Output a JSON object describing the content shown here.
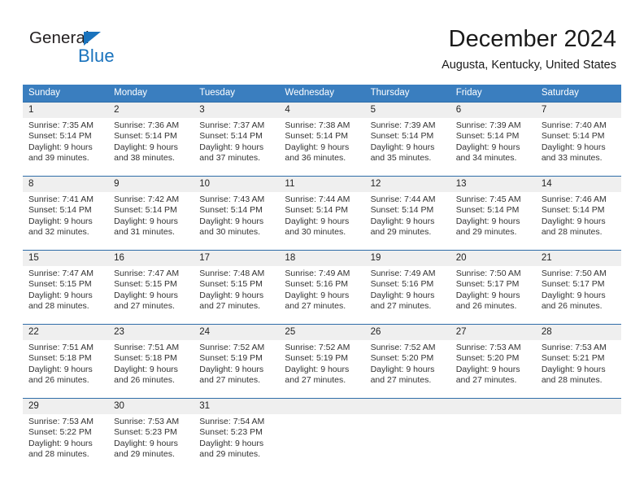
{
  "brand": {
    "name_top": "General",
    "name_bottom": "Blue",
    "accent_color": "#1a73bd"
  },
  "header": {
    "title": "December 2024",
    "subtitle": "Augusta, Kentucky, United States"
  },
  "calendar": {
    "header_color": "#3a7ebf",
    "weekdays": [
      "Sunday",
      "Monday",
      "Tuesday",
      "Wednesday",
      "Thursday",
      "Friday",
      "Saturday"
    ],
    "weeks": [
      {
        "days": [
          {
            "num": "1",
            "sunrise": "Sunrise: 7:35 AM",
            "sunset": "Sunset: 5:14 PM",
            "daylight_1": "Daylight: 9 hours",
            "daylight_2": "and 39 minutes."
          },
          {
            "num": "2",
            "sunrise": "Sunrise: 7:36 AM",
            "sunset": "Sunset: 5:14 PM",
            "daylight_1": "Daylight: 9 hours",
            "daylight_2": "and 38 minutes."
          },
          {
            "num": "3",
            "sunrise": "Sunrise: 7:37 AM",
            "sunset": "Sunset: 5:14 PM",
            "daylight_1": "Daylight: 9 hours",
            "daylight_2": "and 37 minutes."
          },
          {
            "num": "4",
            "sunrise": "Sunrise: 7:38 AM",
            "sunset": "Sunset: 5:14 PM",
            "daylight_1": "Daylight: 9 hours",
            "daylight_2": "and 36 minutes."
          },
          {
            "num": "5",
            "sunrise": "Sunrise: 7:39 AM",
            "sunset": "Sunset: 5:14 PM",
            "daylight_1": "Daylight: 9 hours",
            "daylight_2": "and 35 minutes."
          },
          {
            "num": "6",
            "sunrise": "Sunrise: 7:39 AM",
            "sunset": "Sunset: 5:14 PM",
            "daylight_1": "Daylight: 9 hours",
            "daylight_2": "and 34 minutes."
          },
          {
            "num": "7",
            "sunrise": "Sunrise: 7:40 AM",
            "sunset": "Sunset: 5:14 PM",
            "daylight_1": "Daylight: 9 hours",
            "daylight_2": "and 33 minutes."
          }
        ]
      },
      {
        "days": [
          {
            "num": "8",
            "sunrise": "Sunrise: 7:41 AM",
            "sunset": "Sunset: 5:14 PM",
            "daylight_1": "Daylight: 9 hours",
            "daylight_2": "and 32 minutes."
          },
          {
            "num": "9",
            "sunrise": "Sunrise: 7:42 AM",
            "sunset": "Sunset: 5:14 PM",
            "daylight_1": "Daylight: 9 hours",
            "daylight_2": "and 31 minutes."
          },
          {
            "num": "10",
            "sunrise": "Sunrise: 7:43 AM",
            "sunset": "Sunset: 5:14 PM",
            "daylight_1": "Daylight: 9 hours",
            "daylight_2": "and 30 minutes."
          },
          {
            "num": "11",
            "sunrise": "Sunrise: 7:44 AM",
            "sunset": "Sunset: 5:14 PM",
            "daylight_1": "Daylight: 9 hours",
            "daylight_2": "and 30 minutes."
          },
          {
            "num": "12",
            "sunrise": "Sunrise: 7:44 AM",
            "sunset": "Sunset: 5:14 PM",
            "daylight_1": "Daylight: 9 hours",
            "daylight_2": "and 29 minutes."
          },
          {
            "num": "13",
            "sunrise": "Sunrise: 7:45 AM",
            "sunset": "Sunset: 5:14 PM",
            "daylight_1": "Daylight: 9 hours",
            "daylight_2": "and 29 minutes."
          },
          {
            "num": "14",
            "sunrise": "Sunrise: 7:46 AM",
            "sunset": "Sunset: 5:14 PM",
            "daylight_1": "Daylight: 9 hours",
            "daylight_2": "and 28 minutes."
          }
        ]
      },
      {
        "days": [
          {
            "num": "15",
            "sunrise": "Sunrise: 7:47 AM",
            "sunset": "Sunset: 5:15 PM",
            "daylight_1": "Daylight: 9 hours",
            "daylight_2": "and 28 minutes."
          },
          {
            "num": "16",
            "sunrise": "Sunrise: 7:47 AM",
            "sunset": "Sunset: 5:15 PM",
            "daylight_1": "Daylight: 9 hours",
            "daylight_2": "and 27 minutes."
          },
          {
            "num": "17",
            "sunrise": "Sunrise: 7:48 AM",
            "sunset": "Sunset: 5:15 PM",
            "daylight_1": "Daylight: 9 hours",
            "daylight_2": "and 27 minutes."
          },
          {
            "num": "18",
            "sunrise": "Sunrise: 7:49 AM",
            "sunset": "Sunset: 5:16 PM",
            "daylight_1": "Daylight: 9 hours",
            "daylight_2": "and 27 minutes."
          },
          {
            "num": "19",
            "sunrise": "Sunrise: 7:49 AM",
            "sunset": "Sunset: 5:16 PM",
            "daylight_1": "Daylight: 9 hours",
            "daylight_2": "and 27 minutes."
          },
          {
            "num": "20",
            "sunrise": "Sunrise: 7:50 AM",
            "sunset": "Sunset: 5:17 PM",
            "daylight_1": "Daylight: 9 hours",
            "daylight_2": "and 26 minutes."
          },
          {
            "num": "21",
            "sunrise": "Sunrise: 7:50 AM",
            "sunset": "Sunset: 5:17 PM",
            "daylight_1": "Daylight: 9 hours",
            "daylight_2": "and 26 minutes."
          }
        ]
      },
      {
        "days": [
          {
            "num": "22",
            "sunrise": "Sunrise: 7:51 AM",
            "sunset": "Sunset: 5:18 PM",
            "daylight_1": "Daylight: 9 hours",
            "daylight_2": "and 26 minutes."
          },
          {
            "num": "23",
            "sunrise": "Sunrise: 7:51 AM",
            "sunset": "Sunset: 5:18 PM",
            "daylight_1": "Daylight: 9 hours",
            "daylight_2": "and 26 minutes."
          },
          {
            "num": "24",
            "sunrise": "Sunrise: 7:52 AM",
            "sunset": "Sunset: 5:19 PM",
            "daylight_1": "Daylight: 9 hours",
            "daylight_2": "and 27 minutes."
          },
          {
            "num": "25",
            "sunrise": "Sunrise: 7:52 AM",
            "sunset": "Sunset: 5:19 PM",
            "daylight_1": "Daylight: 9 hours",
            "daylight_2": "and 27 minutes."
          },
          {
            "num": "26",
            "sunrise": "Sunrise: 7:52 AM",
            "sunset": "Sunset: 5:20 PM",
            "daylight_1": "Daylight: 9 hours",
            "daylight_2": "and 27 minutes."
          },
          {
            "num": "27",
            "sunrise": "Sunrise: 7:53 AM",
            "sunset": "Sunset: 5:20 PM",
            "daylight_1": "Daylight: 9 hours",
            "daylight_2": "and 27 minutes."
          },
          {
            "num": "28",
            "sunrise": "Sunrise: 7:53 AM",
            "sunset": "Sunset: 5:21 PM",
            "daylight_1": "Daylight: 9 hours",
            "daylight_2": "and 28 minutes."
          }
        ]
      },
      {
        "days": [
          {
            "num": "29",
            "sunrise": "Sunrise: 7:53 AM",
            "sunset": "Sunset: 5:22 PM",
            "daylight_1": "Daylight: 9 hours",
            "daylight_2": "and 28 minutes."
          },
          {
            "num": "30",
            "sunrise": "Sunrise: 7:53 AM",
            "sunset": "Sunset: 5:23 PM",
            "daylight_1": "Daylight: 9 hours",
            "daylight_2": "and 29 minutes."
          },
          {
            "num": "31",
            "sunrise": "Sunrise: 7:54 AM",
            "sunset": "Sunset: 5:23 PM",
            "daylight_1": "Daylight: 9 hours",
            "daylight_2": "and 29 minutes."
          },
          {
            "num": "",
            "sunrise": "",
            "sunset": "",
            "daylight_1": "",
            "daylight_2": ""
          },
          {
            "num": "",
            "sunrise": "",
            "sunset": "",
            "daylight_1": "",
            "daylight_2": ""
          },
          {
            "num": "",
            "sunrise": "",
            "sunset": "",
            "daylight_1": "",
            "daylight_2": ""
          },
          {
            "num": "",
            "sunrise": "",
            "sunset": "",
            "daylight_1": "",
            "daylight_2": ""
          }
        ]
      }
    ]
  }
}
